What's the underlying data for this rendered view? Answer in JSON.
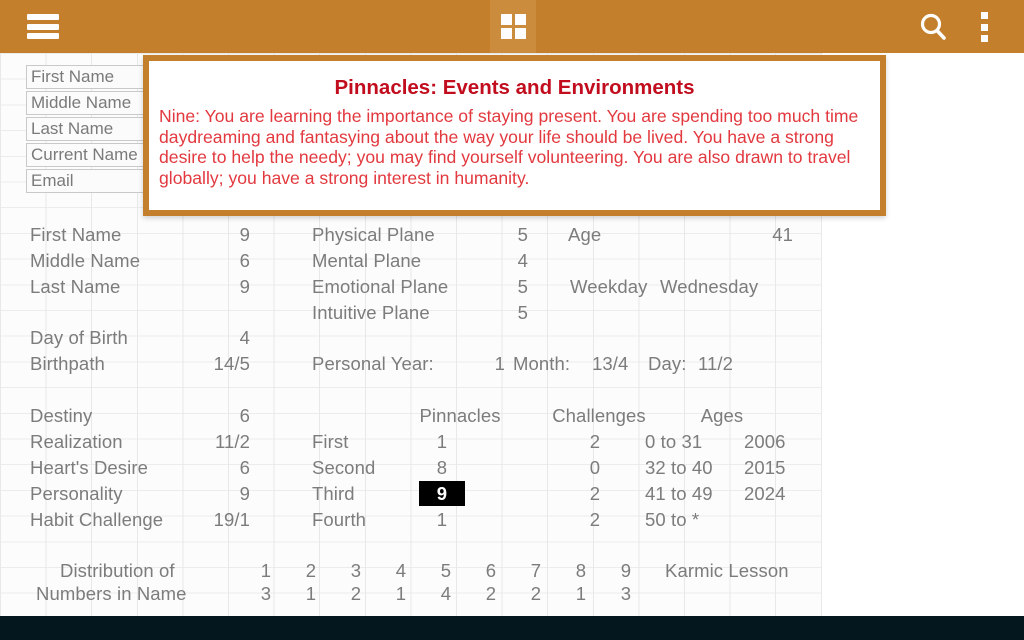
{
  "appbar": {
    "menu_icon": "hamburger-icon",
    "grid_icon": "grid-apps-icon",
    "search_icon": "search-icon",
    "overflow_icon": "more-vertical-icon",
    "bg_color": "#c47f2c"
  },
  "form": {
    "fields": [
      {
        "placeholder": "First Name"
      },
      {
        "placeholder": "Middle Name"
      },
      {
        "placeholder": "Last Name"
      },
      {
        "placeholder": "Current Name"
      },
      {
        "placeholder": "Email"
      }
    ]
  },
  "popup": {
    "title": "Pinnacles: Events and Environments",
    "body": "Nine:  You are learning the importance of staying present. You are spending too much time daydreaming and fantasying about the way your life should be lived. You have a strong desire to help the needy; you may find yourself volunteering. You are also drawn to travel globally; you have a strong interest in humanity.",
    "title_color": "#c10d1e",
    "body_color": "#e2393f",
    "border_color": "#c47f2c"
  },
  "sheet": {
    "name_numbers": [
      {
        "label": "First Name",
        "value": "9"
      },
      {
        "label": "Middle Name",
        "value": "6"
      },
      {
        "label": "Last Name",
        "value": "9"
      }
    ],
    "birth": [
      {
        "label": "Day of Birth",
        "value": "4"
      },
      {
        "label": "Birthpath",
        "value": "14/5"
      }
    ],
    "planes": [
      {
        "label": "Physical Plane",
        "value": "5"
      },
      {
        "label": "Mental Plane",
        "value": "4"
      },
      {
        "label": "Emotional Plane",
        "value": "5"
      },
      {
        "label": "Intuitive Plane",
        "value": "5"
      }
    ],
    "age": {
      "label": "Age",
      "value": "41"
    },
    "weekday": {
      "label": "Weekday",
      "value": "Wednesday"
    },
    "personal": {
      "year_label": "Personal Year:",
      "year_value": "1",
      "month_label": "Month:",
      "month_value": "13/4",
      "day_label": "Day:",
      "day_value": "11/2"
    },
    "core": [
      {
        "label": "Destiny",
        "value": "6"
      },
      {
        "label": "Realization",
        "value": "11/2"
      },
      {
        "label": "Heart's Desire",
        "value": "6"
      },
      {
        "label": "Personality",
        "value": "9"
      },
      {
        "label": "Habit Challenge",
        "value": "19/1"
      }
    ],
    "pinnacle_headers": {
      "pinnacles": "Pinnacles",
      "challenges": "Challenges",
      "ages": "Ages"
    },
    "pinnacle_rows": [
      {
        "ordinal": "First",
        "pinnacle": "1",
        "challenge": "2",
        "ages": "0 to 31",
        "year": "2006",
        "selected": false
      },
      {
        "ordinal": "Second",
        "pinnacle": "8",
        "challenge": "0",
        "ages": "32 to 40",
        "year": "2015",
        "selected": false
      },
      {
        "ordinal": "Third",
        "pinnacle": "9",
        "challenge": "2",
        "ages": "41 to 49",
        "year": "2024",
        "selected": true
      },
      {
        "ordinal": "Fourth",
        "pinnacle": "1",
        "challenge": "2",
        "ages": "50 to *",
        "year": "",
        "selected": false
      }
    ],
    "distribution": {
      "label_line1": "Distribution of",
      "label_line2": "Numbers in Name",
      "digits": [
        "1",
        "2",
        "3",
        "4",
        "5",
        "6",
        "7",
        "8",
        "9"
      ],
      "counts": [
        "3",
        "1",
        "2",
        "1",
        "4",
        "2",
        "2",
        "1",
        "3"
      ],
      "karmic_label": "Karmic Lesson",
      "karmic_value": ""
    }
  }
}
